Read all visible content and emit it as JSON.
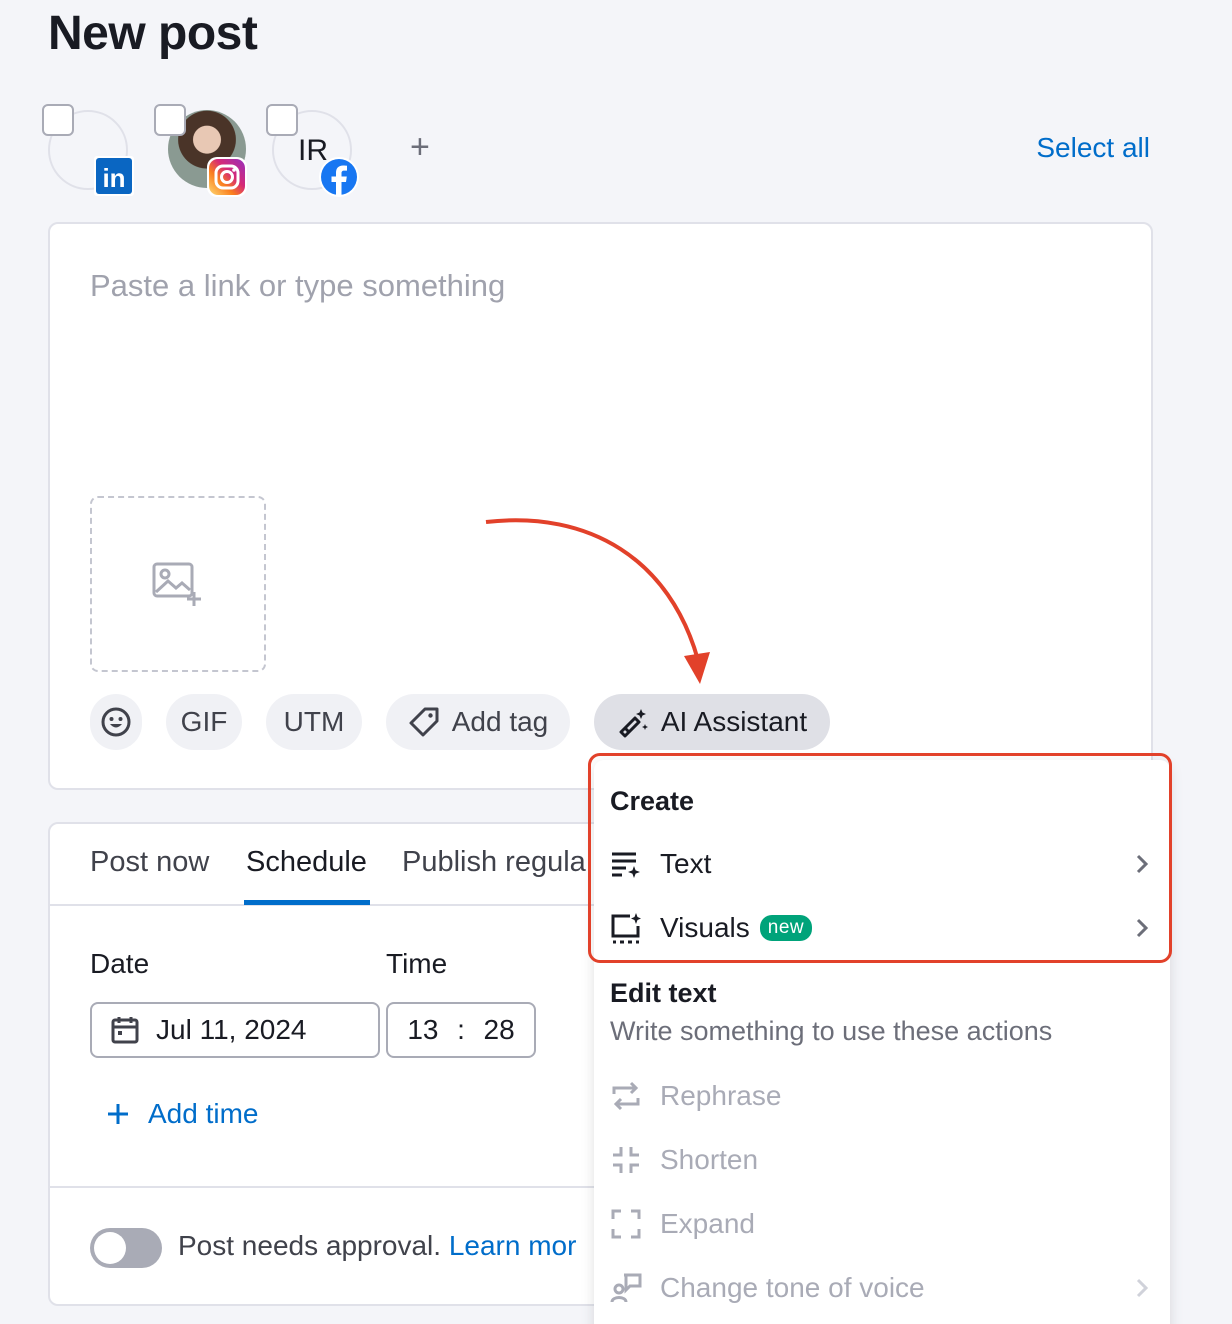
{
  "page": {
    "title": "New post"
  },
  "accounts": [
    {
      "network": "linkedin",
      "badge_text": "in",
      "checked": false
    },
    {
      "network": "instagram",
      "checked": false
    },
    {
      "network": "facebook",
      "initials": "IR",
      "checked": false
    }
  ],
  "header": {
    "add_label": "+",
    "select_all_label": "Select all"
  },
  "composer": {
    "placeholder": "Paste a link or type something",
    "tools": {
      "gif": "GIF",
      "utm": "UTM",
      "add_tag": "Add tag",
      "ai_assistant": "AI Assistant"
    }
  },
  "schedule": {
    "tabs": [
      {
        "label": "Post now",
        "active": false
      },
      {
        "label": "Schedule",
        "active": true
      },
      {
        "label": "Publish regula",
        "active": false
      }
    ],
    "date_label": "Date",
    "time_label": "Time",
    "date_value": "Jul 11, 2024",
    "time_hour": "13",
    "time_sep": ":",
    "time_minute": "28",
    "add_time_label": "Add time",
    "approval_text": "Post needs approval.",
    "learn_more": "Learn mor"
  },
  "ai_menu": {
    "create_heading": "Create",
    "create_items": [
      {
        "label": "Text"
      },
      {
        "label": "Visuals",
        "badge": "new"
      }
    ],
    "edit_heading": "Edit text",
    "edit_hint": "Write something to use these actions",
    "edit_items": [
      {
        "label": "Rephrase"
      },
      {
        "label": "Shorten"
      },
      {
        "label": "Expand"
      },
      {
        "label": "Change tone of voice"
      }
    ]
  },
  "colors": {
    "accent": "#006dca",
    "highlight": "#e2412a",
    "new_badge": "#00a37a",
    "linkedin": "#0a66c2",
    "facebook": "#1877f2"
  }
}
